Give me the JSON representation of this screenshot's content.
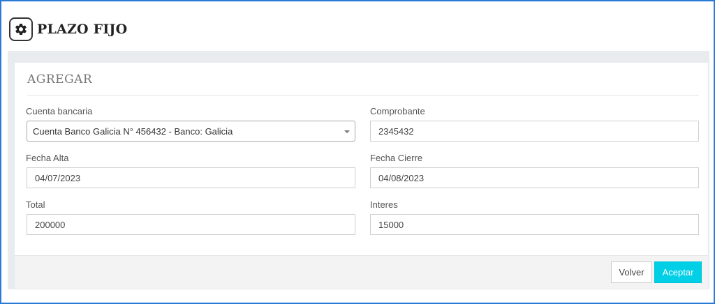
{
  "header": {
    "title": "PLAZO FIJO",
    "icon": "gear-icon"
  },
  "form": {
    "section_title": "AGREGAR",
    "cuenta_bancaria": {
      "label": "Cuenta bancaria",
      "value": "Cuenta Banco Galicia N° 456432 - Banco: Galicia"
    },
    "comprobante": {
      "label": "Comprobante",
      "value": "2345432"
    },
    "fecha_alta": {
      "label": "Fecha Alta",
      "value": "04/07/2023"
    },
    "fecha_cierre": {
      "label": "Fecha Cierre",
      "value": "04/08/2023"
    },
    "total": {
      "label": "Total",
      "value": "200000"
    },
    "interes": {
      "label": "Interes",
      "value": "15000"
    }
  },
  "actions": {
    "volver": "Volver",
    "aceptar": "Aceptar"
  },
  "colors": {
    "accent": "#00cfe6",
    "border": "#2b7bd6"
  }
}
